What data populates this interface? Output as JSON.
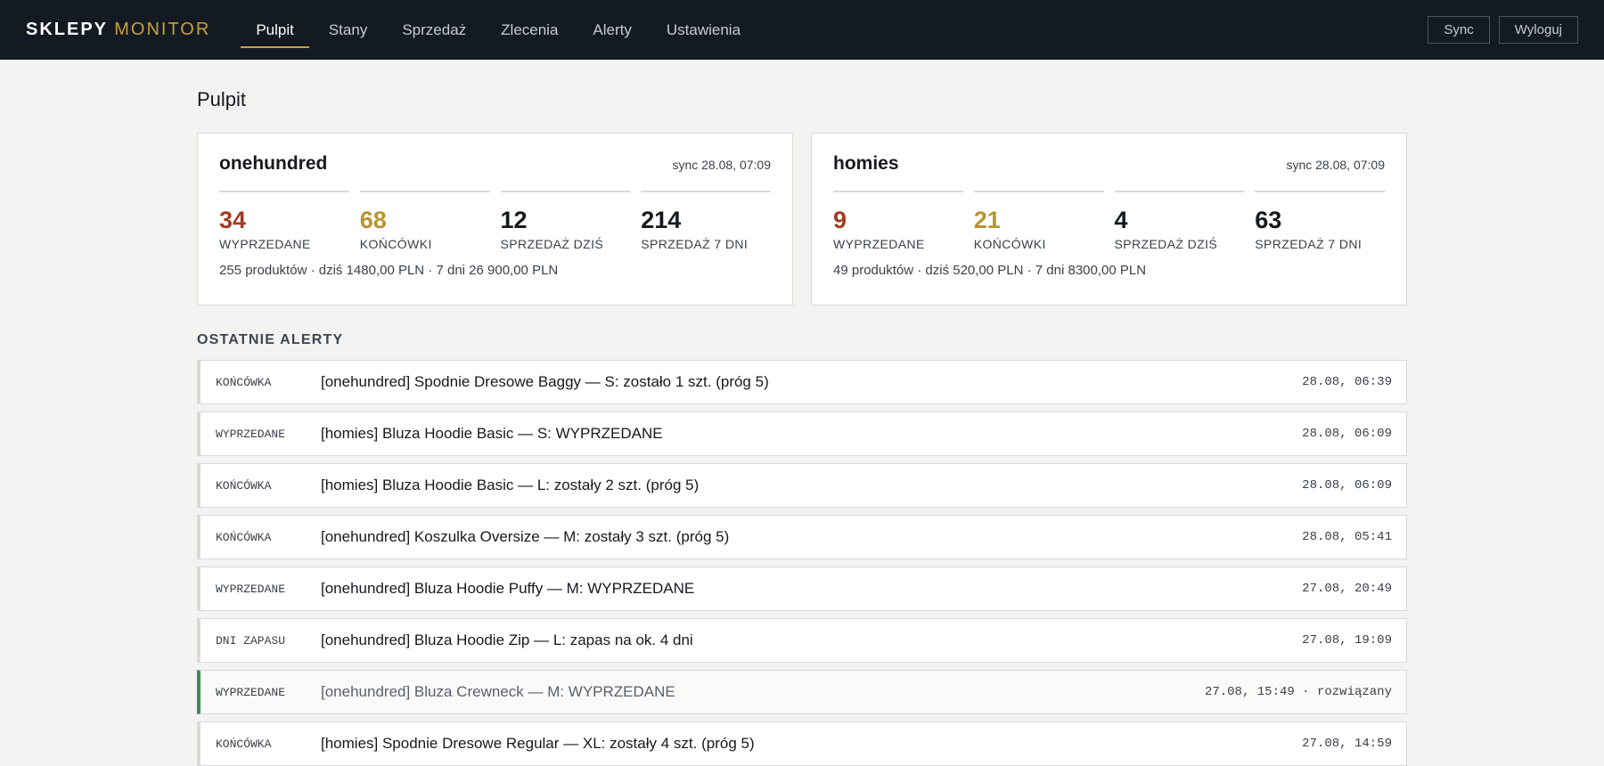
{
  "app": {
    "logo_main": "SKLEPY",
    "logo_accent": "MONITOR"
  },
  "nav": {
    "items": [
      {
        "label": "Pulpit",
        "active": true
      },
      {
        "label": "Stany",
        "active": false
      },
      {
        "label": "Sprzedaż",
        "active": false
      },
      {
        "label": "Zlecenia",
        "active": false
      },
      {
        "label": "Alerty",
        "active": false
      },
      {
        "label": "Ustawienia",
        "active": false
      }
    ]
  },
  "header_actions": {
    "sync_label": "Sync",
    "logout_label": "Wyloguj"
  },
  "page": {
    "title": "Pulpit"
  },
  "shops": [
    {
      "name": "onehundred",
      "sync": "sync 28.08, 07:09",
      "metrics": [
        {
          "value": "34",
          "label": "WYPRZEDANE"
        },
        {
          "value": "68",
          "label": "KOŃCÓWKI"
        },
        {
          "value": "12",
          "label": "SPRZEDAŻ DZIŚ"
        },
        {
          "value": "214",
          "label": "SPRZEDAŻ 7 DNI"
        }
      ],
      "summary": "255 produktów · dziś 1480,00 PLN · 7 dni 26 900,00 PLN"
    },
    {
      "name": "homies",
      "sync": "sync 28.08, 07:09",
      "metrics": [
        {
          "value": "9",
          "label": "WYPRZEDANE"
        },
        {
          "value": "21",
          "label": "KOŃCÓWKI"
        },
        {
          "value": "4",
          "label": "SPRZEDAŻ DZIŚ"
        },
        {
          "value": "63",
          "label": "SPRZEDAŻ 7 DNI"
        }
      ],
      "summary": "49 produktów · dziś 520,00 PLN · 7 dni 8300,00 PLN"
    }
  ],
  "alerts_section": {
    "title": "OSTATNIE ALERTY"
  },
  "alerts": [
    {
      "type": "KOŃCÓWKA",
      "text": "[onehundred] Spodnie Dresowe Baggy — S: zostało 1 szt. (próg 5)",
      "time": "28.08, 06:39"
    },
    {
      "type": "WYPRZEDANE",
      "text": "[homies] Bluza Hoodie Basic — S: WYPRZEDANE",
      "time": "28.08, 06:09"
    },
    {
      "type": "KOŃCÓWKA",
      "text": "[homies] Bluza Hoodie Basic — L: zostały 2 szt. (próg 5)",
      "time": "28.08, 06:09"
    },
    {
      "type": "KOŃCÓWKA",
      "text": "[onehundred] Koszulka Oversize — M: zostały 3 szt. (próg 5)",
      "time": "28.08, 05:41"
    },
    {
      "type": "WYPRZEDANE",
      "text": "[onehundred] Bluza Hoodie Puffy — M: WYPRZEDANE",
      "time": "27.08, 20:49"
    },
    {
      "type": "DNI ZAPASU",
      "text": "[onehundred] Bluza Hoodie Zip — L: zapas na ok. 4 dni",
      "time": "27.08, 19:09"
    },
    {
      "type": "WYPRZEDANE",
      "text": "[onehundred] Bluza Crewneck — M: WYPRZEDANE",
      "time": "27.08, 15:49 · rozwiązany",
      "resolved": true
    },
    {
      "type": "KOŃCÓWKA",
      "text": "[homies] Spodnie Dresowe Regular — XL: zostały 4 szt. (próg 5)",
      "time": "27.08, 14:59"
    }
  ],
  "colors": {
    "accent": "#c9a13a",
    "soldout": "#a23b22",
    "lowstock": "#b8952f",
    "resolved": "#3f8b58",
    "topbar": "#141a22"
  }
}
